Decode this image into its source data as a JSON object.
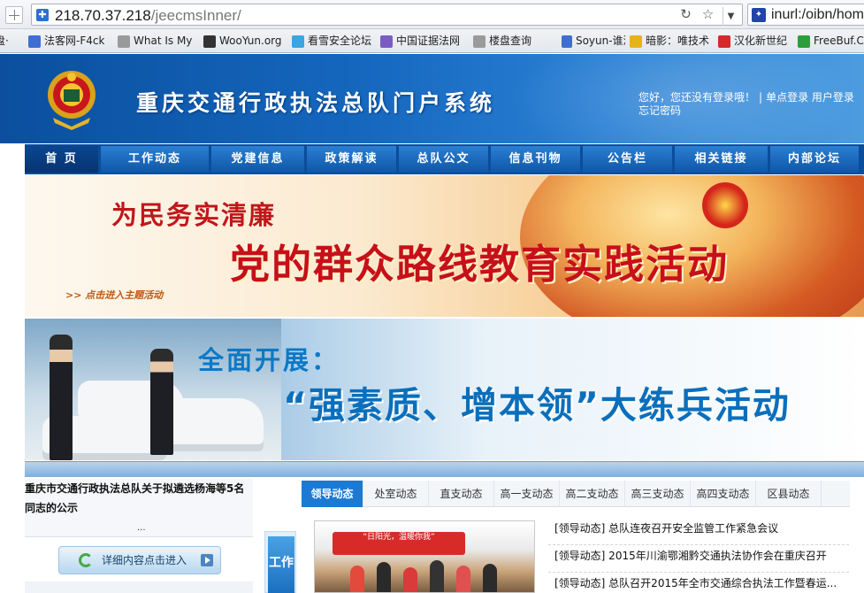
{
  "browser": {
    "url_main": "218.70.37.218",
    "url_path": "/jeecmsInner/",
    "search_value": "inurl:/oibn/hom",
    "bookmarks": [
      {
        "label": "盘·",
        "color": "#6b7a8c"
      },
      {
        "label": "法客网-F4ck",
        "color": "#3d6fd1"
      },
      {
        "label": "What Is My",
        "color": "#9a9a9a"
      },
      {
        "label": "WooYun.org",
        "color": "#333333"
      },
      {
        "label": "看雪安全论坛",
        "color": "#3ba5e0"
      },
      {
        "label": "中国证据法网",
        "color": "#7a5cc4"
      },
      {
        "label": "楼盘查询",
        "color": "#9a9a9a"
      },
      {
        "label": "Soyun-谁泄",
        "color": "#3d6fd1"
      },
      {
        "label": "暗影：唯技术",
        "color": "#e8b21a"
      },
      {
        "label": "汉化新世纪",
        "color": "#d42a2a"
      },
      {
        "label": "FreeBuf.C",
        "color": "#2e9e3a"
      }
    ]
  },
  "site": {
    "title": "重庆交通行政执法总队门户系统",
    "greeting": "您好，您还没有登录哦！",
    "single_login": "单点登录",
    "user_login": "用户登录",
    "forgot_password": "忘记密码",
    "nav": [
      "首 页",
      "工作动态",
      "党建信息",
      "政策解读",
      "总队公文",
      "信息刊物",
      "公告栏",
      "相关链接",
      "内部论坛"
    ]
  },
  "banner1": {
    "line1": "为民务实清廉",
    "line2": "党的群众路线教育实践活动",
    "link": ">> 点击进入主题活动"
  },
  "banner2": {
    "line1": "全面开展：",
    "line2": "“强素质、增本领”大练兵活动"
  },
  "notice": {
    "text": "重庆市交通行政执法总队关于拟遴选杨海等5名同志的公示",
    "more": "...",
    "detail_button": "详细内容点击进入"
  },
  "side_tab": "工作",
  "photo_banner": "“日阳光，温暖你我”",
  "tabs": [
    "领导动态",
    "处室动态",
    "直支动态",
    "高一支动态",
    "高二支动态",
    "高三支动态",
    "高四支动态",
    "区县动态"
  ],
  "news": [
    "[领导动态] 总队连夜召开安全监管工作紧急会议",
    "[领导动态] 2015年川渝鄂湘黔交通执法协作会在重庆召开",
    "[领导动态] 总队召开2015年全市交通综合执法工作暨春运..."
  ]
}
